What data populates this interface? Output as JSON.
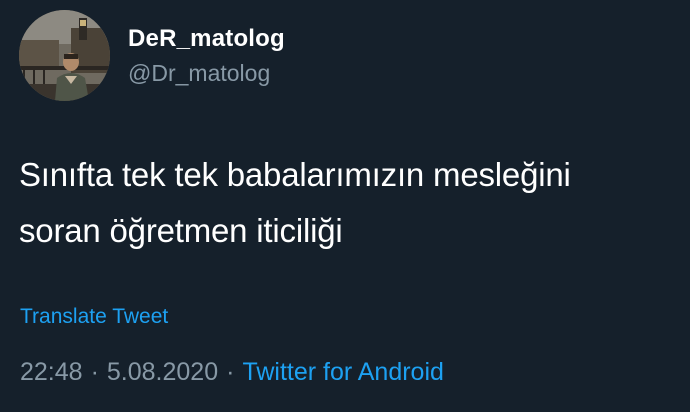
{
  "user": {
    "display_name": "DeR_matolog",
    "handle": "@Dr_matolog"
  },
  "tweet": {
    "text_lines": [
      "Sınıfta tek tek babalarımızın mesleğini",
      "soran öğretmen iticiliği"
    ],
    "translate_label": "Translate Tweet"
  },
  "meta": {
    "time": "22:48",
    "separator": "·",
    "date": "5.08.2020",
    "source": "Twitter for Android"
  },
  "colors": {
    "background": "#15202b",
    "text": "#ffffff",
    "secondary": "#8899a6",
    "link": "#1da1f2"
  }
}
